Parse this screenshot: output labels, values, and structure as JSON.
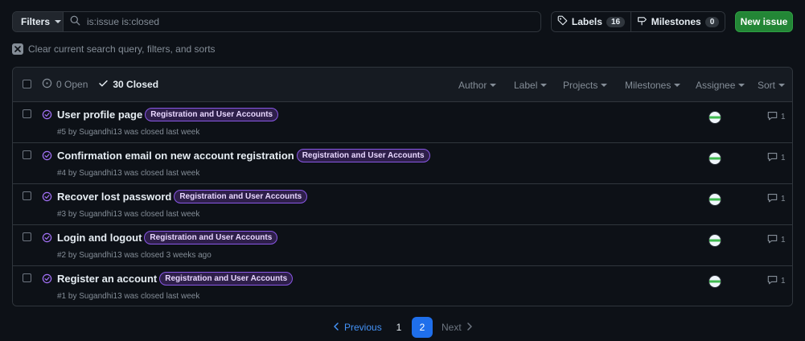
{
  "toolbar": {
    "filters_label": "Filters",
    "search_value": "is:issue is:closed",
    "labels_label": "Labels",
    "labels_count": "16",
    "milestones_label": "Milestones",
    "milestones_count": "0",
    "new_issue_label": "New issue"
  },
  "clear_filters_label": "Clear current search query, filters, and sorts",
  "header": {
    "open_label": "0 Open",
    "closed_label": "30 Closed",
    "sorters": [
      "Author",
      "Label",
      "Projects",
      "Milestones",
      "Assignee",
      "Sort"
    ]
  },
  "issues": [
    {
      "title": "User profile page",
      "label": "Registration and User Accounts",
      "meta": "#5 by Sugandhi13 was closed last week",
      "comments": "1"
    },
    {
      "title": "Confirmation email on new account registration",
      "label": "Registration and User Accounts",
      "meta": "#4 by Sugandhi13 was closed last week",
      "comments": "1"
    },
    {
      "title": "Recover lost password",
      "label": "Registration and User Accounts",
      "meta": "#3 by Sugandhi13 was closed last week",
      "comments": "1"
    },
    {
      "title": "Login and logout",
      "label": "Registration and User Accounts",
      "meta": "#2 by Sugandhi13 was closed 3 weeks ago",
      "comments": "1"
    },
    {
      "title": "Register an account",
      "label": "Registration and User Accounts",
      "meta": "#1 by Sugandhi13 was closed last week",
      "comments": "1"
    }
  ],
  "pagination": {
    "previous_label": "Previous",
    "pages": [
      "1",
      "2"
    ],
    "current_page": "2",
    "next_label": "Next"
  },
  "colors": {
    "background": "#0d1117",
    "border": "#30363d",
    "accent_green": "#238636",
    "closed_purple": "#a371f7",
    "link_blue": "#4493f8",
    "current_page": "#1f6feb"
  }
}
